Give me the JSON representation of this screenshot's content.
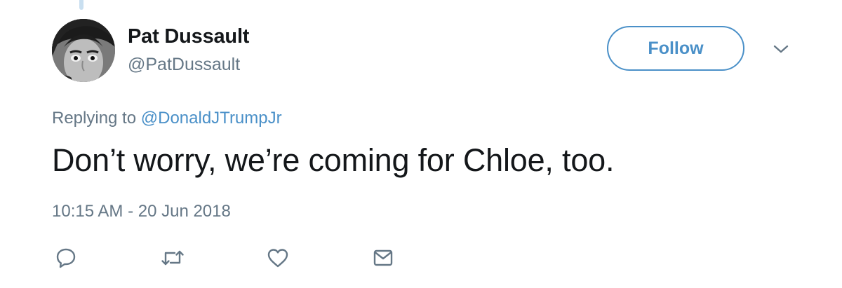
{
  "author": {
    "display_name": "Pat Dussault",
    "handle": "@PatDussault"
  },
  "follow": {
    "label": "Follow"
  },
  "reply_context": {
    "prefix": "Replying to",
    "mention": "@DonaldJTrumpJr"
  },
  "tweet": {
    "text": "Don’t worry, we’re coming for Chloe, too.",
    "timestamp": "10:15 AM - 20 Jun 2018"
  },
  "actions": {
    "icons": [
      "reply-icon",
      "retweet-icon",
      "like-icon",
      "direct-message-icon"
    ]
  },
  "colors": {
    "accent": "#4a90c8",
    "text": "#14171a",
    "secondary_text": "#657786",
    "icon": "#657786"
  }
}
